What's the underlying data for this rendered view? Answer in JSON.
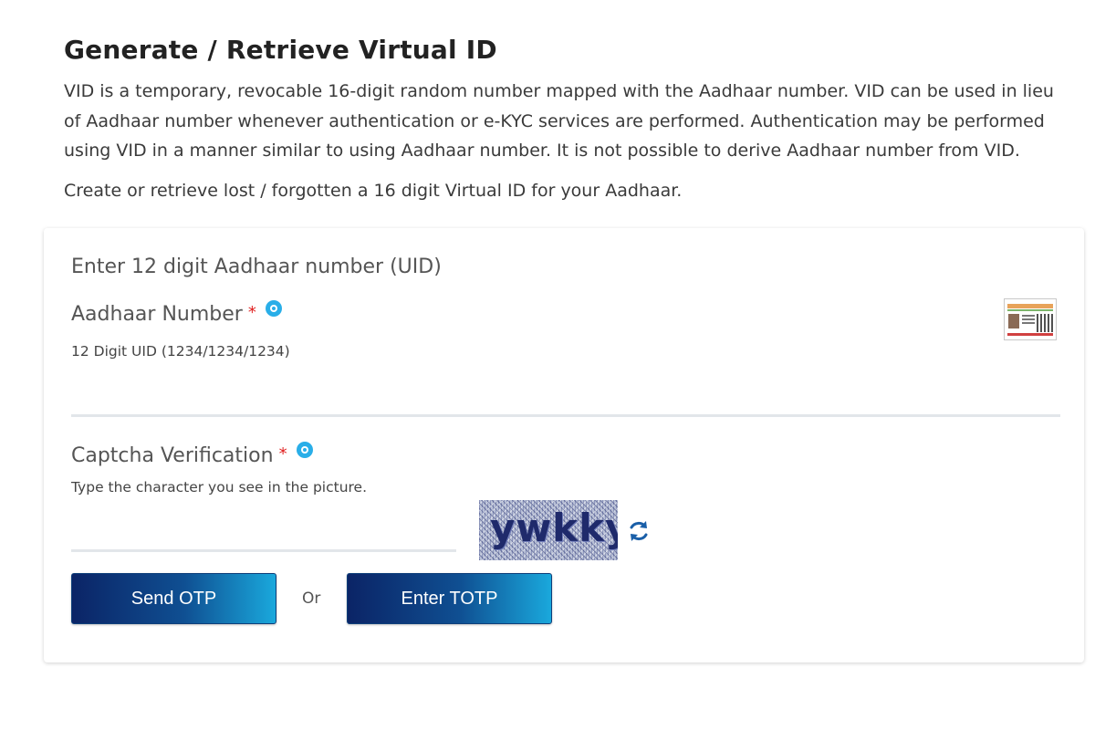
{
  "header": {
    "title": "Generate / Retrieve Virtual ID",
    "description": "VID is a temporary, revocable 16-digit random number mapped with the Aadhaar number. VID can be used in lieu of Aadhaar number whenever authentication or e-KYC services are performed. Authentication may be performed using VID in a manner similar to using Aadhaar number. It is not possible to derive Aadhaar number from VID.",
    "subtitle": "Create or retrieve lost / forgotten a 16 digit Virtual ID for your Aadhaar."
  },
  "form": {
    "heading": "Enter 12 digit Aadhaar number (UID)",
    "aadhaar": {
      "label": "Aadhaar Number",
      "required_mark": "*",
      "hint": "12 Digit UID (1234/1234/1234)",
      "value": ""
    },
    "captcha": {
      "label": "Captcha Verification",
      "required_mark": "*",
      "hint": "Type the character you see in the picture.",
      "value": "",
      "image_text": "ywkky"
    },
    "send_otp_label": "Send OTP",
    "or_label": "Or",
    "enter_totp_label": "Enter TOTP"
  },
  "icons": {
    "info": "info-icon",
    "refresh": "refresh-icon",
    "aadhaar_card": "aadhaar-card-icon"
  },
  "colors": {
    "button_dark": "#0b2466",
    "button_light": "#1aa8dc",
    "info_icon": "#29aee8",
    "required": "#e02020"
  }
}
